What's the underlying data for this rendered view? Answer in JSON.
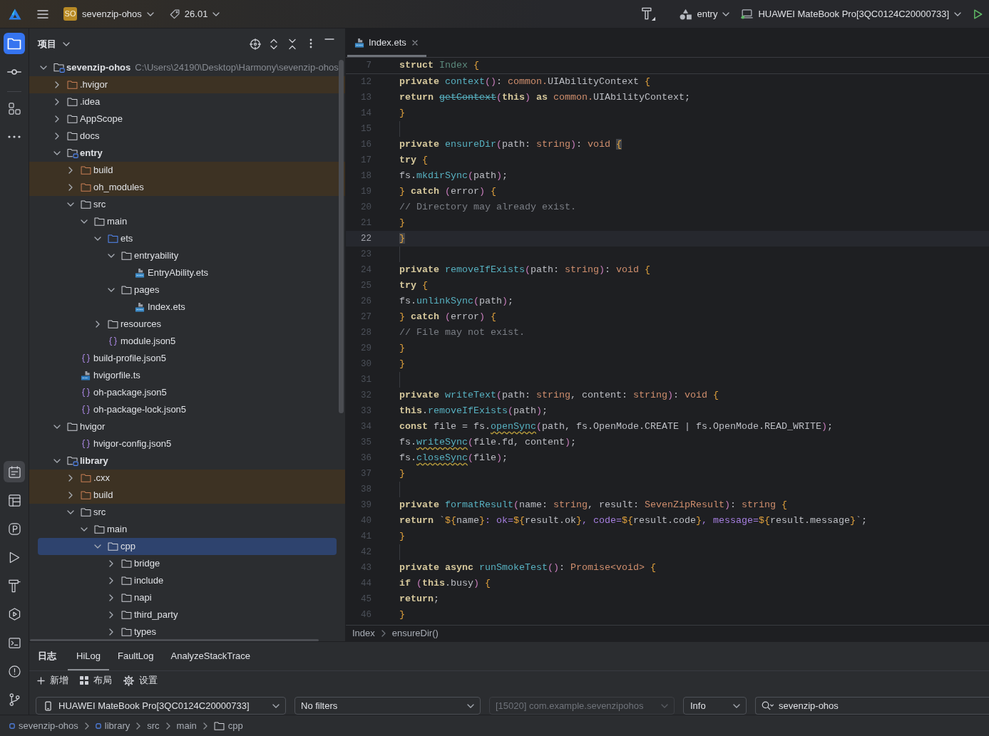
{
  "top_bar": {
    "project_badge": "SO",
    "project": "sevenzip-ohos",
    "version": "26.01",
    "module": "entry",
    "device": "HUAWEI MateBook Pro[3QC0124C20000733]"
  },
  "tool_strip": {
    "top_groups": [
      [
        {
          "kind": "project",
          "selected": true,
          "focused": true
        },
        {
          "kind": "commit",
          "selected": false,
          "focused": false
        }
      ],
      [
        {
          "kind": "structure",
          "selected": false,
          "focused": false
        },
        {
          "kind": "more",
          "selected": false,
          "focused": false
        }
      ]
    ],
    "bottom": [
      {
        "kind": "notes",
        "selected": true,
        "focused": false
      },
      {
        "kind": "layout",
        "selected": false,
        "focused": false
      },
      {
        "kind": "profiler",
        "selected": false,
        "focused": false
      },
      {
        "kind": "run",
        "selected": false,
        "focused": false
      },
      {
        "kind": "build",
        "selected": false,
        "focused": false
      },
      {
        "kind": "services",
        "selected": false,
        "focused": false
      },
      {
        "kind": "terminal",
        "selected": false,
        "focused": false
      },
      {
        "kind": "problems",
        "selected": false,
        "focused": false
      },
      {
        "kind": "git",
        "selected": false,
        "focused": false
      }
    ]
  },
  "project_panel": {
    "title": "项目",
    "tree": [
      {
        "label": "sevenzip-ohos",
        "kind": "module",
        "path": "C:\\Users\\24190\\Desktop\\Harmony\\sevenzip-ohos",
        "expanded": true,
        "selected": false,
        "children": [
          {
            "label": ".hvigor",
            "kind": "excluded",
            "expanded": false,
            "selected": false
          },
          {
            "label": ".idea",
            "kind": "folder",
            "expanded": false,
            "selected": false
          },
          {
            "label": "AppScope",
            "kind": "folder",
            "expanded": false,
            "selected": false
          },
          {
            "label": "docs",
            "kind": "folder",
            "expanded": false,
            "selected": false
          },
          {
            "label": "entry",
            "kind": "module",
            "expanded": true,
            "selected": false,
            "children": [
              {
                "label": "build",
                "kind": "excluded",
                "expanded": false,
                "selected": false
              },
              {
                "label": "oh_modules",
                "kind": "excluded",
                "expanded": false,
                "selected": false
              },
              {
                "label": "src",
                "kind": "folder",
                "expanded": true,
                "selected": false,
                "children": [
                  {
                    "label": "main",
                    "kind": "folder",
                    "expanded": true,
                    "selected": false,
                    "children": [
                      {
                        "label": "ets",
                        "kind": "source",
                        "expanded": true,
                        "selected": false,
                        "children": [
                          {
                            "label": "entryability",
                            "kind": "folder",
                            "expanded": true,
                            "selected": false,
                            "children": [
                              {
                                "label": "EntryAbility.ets",
                                "kind": "ets",
                                "selected": false
                              }
                            ]
                          },
                          {
                            "label": "pages",
                            "kind": "folder",
                            "expanded": true,
                            "selected": false,
                            "children": [
                              {
                                "label": "Index.ets",
                                "kind": "ets",
                                "selected": false
                              }
                            ]
                          }
                        ]
                      },
                      {
                        "label": "resources",
                        "kind": "folder",
                        "expanded": false,
                        "selected": false
                      },
                      {
                        "label": "module.json5",
                        "kind": "json",
                        "selected": false
                      }
                    ]
                  }
                ]
              },
              {
                "label": "build-profile.json5",
                "kind": "json",
                "selected": false
              },
              {
                "label": "hvigorfile.ts",
                "kind": "ts",
                "selected": false
              },
              {
                "label": "oh-package.json5",
                "kind": "json",
                "selected": false
              },
              {
                "label": "oh-package-lock.json5",
                "kind": "json",
                "selected": false
              }
            ]
          },
          {
            "label": "hvigor",
            "kind": "folder",
            "expanded": true,
            "selected": false,
            "children": [
              {
                "label": "hvigor-config.json5",
                "kind": "json",
                "selected": false
              }
            ]
          },
          {
            "label": "library",
            "kind": "module",
            "expanded": true,
            "selected": false,
            "children": [
              {
                "label": ".cxx",
                "kind": "excluded",
                "expanded": false,
                "selected": false
              },
              {
                "label": "build",
                "kind": "excluded",
                "expanded": false,
                "selected": false
              },
              {
                "label": "src",
                "kind": "folder",
                "expanded": true,
                "selected": false,
                "children": [
                  {
                    "label": "main",
                    "kind": "folder",
                    "expanded": true,
                    "selected": false,
                    "children": [
                      {
                        "label": "cpp",
                        "kind": "folder",
                        "expanded": true,
                        "selected": true,
                        "children": [
                          {
                            "label": "bridge",
                            "kind": "folder",
                            "expanded": false,
                            "selected": false
                          },
                          {
                            "label": "include",
                            "kind": "folder",
                            "expanded": false,
                            "selected": false
                          },
                          {
                            "label": "napi",
                            "kind": "folder",
                            "expanded": false,
                            "selected": false
                          },
                          {
                            "label": "third_party",
                            "kind": "folder",
                            "expanded": false,
                            "selected": false
                          },
                          {
                            "label": "types",
                            "kind": "folder",
                            "expanded": false,
                            "selected": false
                          }
                        ]
                      }
                    ]
                  }
                ]
              }
            ]
          }
        ]
      }
    ]
  },
  "editor": {
    "tabs": [
      {
        "label": "Index.ets",
        "selected": true
      }
    ],
    "sticky_line": {
      "number": "7",
      "tokens": [
        {
          "kind": "keyword",
          "text": "struct "
        },
        {
          "kind": "class",
          "text": "Index "
        },
        {
          "kind": "brace",
          "text": "{"
        }
      ]
    },
    "lines": [
      {
        "number": "12",
        "current": false,
        "tokens": [
          {
            "kind": "keyword",
            "text": "  private "
          },
          {
            "kind": "function",
            "text": "context"
          },
          {
            "kind": "paren",
            "text": "()"
          },
          {
            "kind": "plain",
            "text": ": "
          },
          {
            "kind": "type",
            "text": "common."
          },
          {
            "kind": "plain",
            "text": "UIAbilityContext "
          },
          {
            "kind": "brace",
            "text": "{"
          }
        ]
      },
      {
        "number": "13",
        "current": false,
        "tokens": [
          {
            "kind": "keyword",
            "text": "    return "
          },
          {
            "kind": "deprecated",
            "text": "getContext"
          },
          {
            "kind": "paren",
            "text": "("
          },
          {
            "kind": "keyword",
            "text": "this"
          },
          {
            "kind": "paren",
            "text": ") "
          },
          {
            "kind": "keyword",
            "text": "as "
          },
          {
            "kind": "type",
            "text": "common."
          },
          {
            "kind": "plain",
            "text": "UIAbilityContext;"
          }
        ]
      },
      {
        "number": "14",
        "current": false,
        "tokens": [
          {
            "kind": "brace",
            "text": "  }"
          }
        ]
      },
      {
        "number": "15",
        "current": false
      },
      {
        "number": "16",
        "current": false,
        "tokens": [
          {
            "kind": "keyword",
            "text": "  private "
          },
          {
            "kind": "function",
            "text": "ensureDir"
          },
          {
            "kind": "paren",
            "text": "("
          },
          {
            "kind": "plain",
            "text": "path: "
          },
          {
            "kind": "type",
            "text": "string"
          },
          {
            "kind": "paren",
            "text": ")"
          },
          {
            "kind": "plain",
            "text": ": "
          },
          {
            "kind": "type",
            "text": "void "
          },
          {
            "kind": "bracematch",
            "text": "{"
          }
        ]
      },
      {
        "number": "17",
        "current": false,
        "tokens": [
          {
            "kind": "keyword",
            "text": "    try "
          },
          {
            "kind": "brace",
            "text": "{"
          }
        ]
      },
      {
        "number": "18",
        "current": false,
        "tokens": [
          {
            "kind": "plain",
            "text": "      fs."
          },
          {
            "kind": "function",
            "text": "mkdirSync"
          },
          {
            "kind": "paren",
            "text": "("
          },
          {
            "kind": "plain",
            "text": "path"
          },
          {
            "kind": "paren",
            "text": ")"
          },
          {
            "kind": "plain",
            "text": ";"
          }
        ]
      },
      {
        "number": "19",
        "current": false,
        "tokens": [
          {
            "kind": "brace",
            "text": "    } "
          },
          {
            "kind": "keyword",
            "text": "catch "
          },
          {
            "kind": "paren",
            "text": "("
          },
          {
            "kind": "plain",
            "text": "error"
          },
          {
            "kind": "paren",
            "text": ") "
          },
          {
            "kind": "brace",
            "text": "{"
          }
        ]
      },
      {
        "number": "20",
        "current": false,
        "tokens": [
          {
            "kind": "comment",
            "text": "      // Directory may already exist."
          }
        ]
      },
      {
        "number": "21",
        "current": false,
        "tokens": [
          {
            "kind": "brace",
            "text": "    }"
          }
        ]
      },
      {
        "number": "22",
        "current": true,
        "tokens": [
          {
            "kind": "bracematch",
            "text": "  }"
          }
        ]
      },
      {
        "number": "23",
        "current": false
      },
      {
        "number": "24",
        "current": false,
        "tokens": [
          {
            "kind": "keyword",
            "text": "  private "
          },
          {
            "kind": "function",
            "text": "removeIfExists"
          },
          {
            "kind": "paren",
            "text": "("
          },
          {
            "kind": "plain",
            "text": "path: "
          },
          {
            "kind": "type",
            "text": "string"
          },
          {
            "kind": "paren",
            "text": ")"
          },
          {
            "kind": "plain",
            "text": ": "
          },
          {
            "kind": "type",
            "text": "void "
          },
          {
            "kind": "brace",
            "text": "{"
          }
        ]
      },
      {
        "number": "25",
        "current": false,
        "tokens": [
          {
            "kind": "keyword",
            "text": "    try "
          },
          {
            "kind": "brace",
            "text": "{"
          }
        ]
      },
      {
        "number": "26",
        "current": false,
        "tokens": [
          {
            "kind": "plain",
            "text": "      fs."
          },
          {
            "kind": "function",
            "text": "unlinkSync"
          },
          {
            "kind": "paren",
            "text": "("
          },
          {
            "kind": "plain",
            "text": "path"
          },
          {
            "kind": "paren",
            "text": ")"
          },
          {
            "kind": "plain",
            "text": ";"
          }
        ]
      },
      {
        "number": "27",
        "current": false,
        "tokens": [
          {
            "kind": "brace",
            "text": "    } "
          },
          {
            "kind": "keyword",
            "text": "catch "
          },
          {
            "kind": "paren",
            "text": "("
          },
          {
            "kind": "plain",
            "text": "error"
          },
          {
            "kind": "paren",
            "text": ") "
          },
          {
            "kind": "brace",
            "text": "{"
          }
        ]
      },
      {
        "number": "28",
        "current": false,
        "tokens": [
          {
            "kind": "comment",
            "text": "      // File may not exist."
          }
        ]
      },
      {
        "number": "29",
        "current": false,
        "tokens": [
          {
            "kind": "brace",
            "text": "    }"
          }
        ]
      },
      {
        "number": "30",
        "current": false,
        "tokens": [
          {
            "kind": "brace",
            "text": "  }"
          }
        ]
      },
      {
        "number": "31",
        "current": false
      },
      {
        "number": "32",
        "current": false,
        "tokens": [
          {
            "kind": "keyword",
            "text": "  private "
          },
          {
            "kind": "function",
            "text": "writeText"
          },
          {
            "kind": "paren",
            "text": "("
          },
          {
            "kind": "plain",
            "text": "path: "
          },
          {
            "kind": "type",
            "text": "string"
          },
          {
            "kind": "plain",
            "text": ", content: "
          },
          {
            "kind": "type",
            "text": "string"
          },
          {
            "kind": "paren",
            "text": ")"
          },
          {
            "kind": "plain",
            "text": ": "
          },
          {
            "kind": "type",
            "text": "void "
          },
          {
            "kind": "brace",
            "text": "{"
          }
        ]
      },
      {
        "number": "33",
        "current": false,
        "tokens": [
          {
            "kind": "keyword",
            "text": "    this"
          },
          {
            "kind": "plain",
            "text": "."
          },
          {
            "kind": "function",
            "text": "removeIfExists"
          },
          {
            "kind": "paren",
            "text": "("
          },
          {
            "kind": "plain",
            "text": "path"
          },
          {
            "kind": "paren",
            "text": ")"
          },
          {
            "kind": "plain",
            "text": ";"
          }
        ]
      },
      {
        "number": "34",
        "current": false,
        "tokens": [
          {
            "kind": "keyword",
            "text": "    const "
          },
          {
            "kind": "plain",
            "text": "file = fs."
          },
          {
            "kind": "flagged",
            "text": "openSync"
          },
          {
            "kind": "paren",
            "text": "("
          },
          {
            "kind": "plain",
            "text": "path, fs.OpenMode.CREATE | fs.OpenMode.READ_WRITE"
          },
          {
            "kind": "paren",
            "text": ")"
          },
          {
            "kind": "plain",
            "text": ";"
          }
        ]
      },
      {
        "number": "35",
        "current": false,
        "tokens": [
          {
            "kind": "plain",
            "text": "    fs."
          },
          {
            "kind": "flagged",
            "text": "writeSync"
          },
          {
            "kind": "paren",
            "text": "("
          },
          {
            "kind": "plain",
            "text": "file.fd, content"
          },
          {
            "kind": "paren",
            "text": ")"
          },
          {
            "kind": "plain",
            "text": ";"
          }
        ]
      },
      {
        "number": "36",
        "current": false,
        "tokens": [
          {
            "kind": "plain",
            "text": "    fs."
          },
          {
            "kind": "flagged",
            "text": "closeSync"
          },
          {
            "kind": "paren",
            "text": "("
          },
          {
            "kind": "plain",
            "text": "file"
          },
          {
            "kind": "paren",
            "text": ")"
          },
          {
            "kind": "plain",
            "text": ";"
          }
        ]
      },
      {
        "number": "37",
        "current": false,
        "tokens": [
          {
            "kind": "brace",
            "text": "  }"
          }
        ]
      },
      {
        "number": "38",
        "current": false
      },
      {
        "number": "39",
        "current": false,
        "tokens": [
          {
            "kind": "keyword",
            "text": "  private "
          },
          {
            "kind": "function",
            "text": "formatResult"
          },
          {
            "kind": "paren",
            "text": "("
          },
          {
            "kind": "plain",
            "text": "name: "
          },
          {
            "kind": "type",
            "text": "string"
          },
          {
            "kind": "plain",
            "text": ", result: "
          },
          {
            "kind": "type",
            "text": "SevenZipResult"
          },
          {
            "kind": "paren",
            "text": ")"
          },
          {
            "kind": "plain",
            "text": ": "
          },
          {
            "kind": "type",
            "text": "string "
          },
          {
            "kind": "brace",
            "text": "{"
          }
        ]
      },
      {
        "number": "40",
        "current": false,
        "tokens": [
          {
            "kind": "keyword",
            "text": "    return "
          },
          {
            "kind": "plain",
            "text": "`"
          },
          {
            "kind": "brace",
            "text": "${"
          },
          {
            "kind": "plain",
            "text": "name"
          },
          {
            "kind": "brace",
            "text": "}"
          },
          {
            "kind": "template",
            "text": ": ok="
          },
          {
            "kind": "brace",
            "text": "${"
          },
          {
            "kind": "plain",
            "text": "result.ok"
          },
          {
            "kind": "brace",
            "text": "}"
          },
          {
            "kind": "template",
            "text": ", code="
          },
          {
            "kind": "brace",
            "text": "${"
          },
          {
            "kind": "plain",
            "text": "result.code"
          },
          {
            "kind": "brace",
            "text": "}"
          },
          {
            "kind": "template",
            "text": ", message="
          },
          {
            "kind": "brace",
            "text": "${"
          },
          {
            "kind": "plain",
            "text": "result.message"
          },
          {
            "kind": "brace",
            "text": "}"
          },
          {
            "kind": "plain",
            "text": "`;"
          }
        ]
      },
      {
        "number": "41",
        "current": false,
        "tokens": [
          {
            "kind": "brace",
            "text": "  }"
          }
        ]
      },
      {
        "number": "42",
        "current": false
      },
      {
        "number": "43",
        "current": false,
        "tokens": [
          {
            "kind": "keyword",
            "text": "  private async "
          },
          {
            "kind": "function",
            "text": "runSmokeTest"
          },
          {
            "kind": "paren",
            "text": "()"
          },
          {
            "kind": "plain",
            "text": ": "
          },
          {
            "kind": "type",
            "text": "Promise<void> "
          },
          {
            "kind": "brace",
            "text": "{"
          }
        ]
      },
      {
        "number": "44",
        "current": false,
        "tokens": [
          {
            "kind": "keyword",
            "text": "    if "
          },
          {
            "kind": "paren",
            "text": "("
          },
          {
            "kind": "keyword",
            "text": "this"
          },
          {
            "kind": "plain",
            "text": ".busy"
          },
          {
            "kind": "paren",
            "text": ") "
          },
          {
            "kind": "brace",
            "text": "{"
          }
        ]
      },
      {
        "number": "45",
        "current": false,
        "tokens": [
          {
            "kind": "keyword",
            "text": "      return"
          },
          {
            "kind": "plain",
            "text": ";"
          }
        ]
      },
      {
        "number": "46",
        "current": false,
        "tokens": [
          {
            "kind": "brace",
            "text": "    }"
          }
        ]
      }
    ],
    "breadcrumb": [
      "Index",
      "ensureDir()"
    ]
  },
  "log_panel": {
    "title": "日志",
    "tabs": [
      {
        "label": "HiLog",
        "selected": true
      },
      {
        "label": "FaultLog",
        "selected": false
      },
      {
        "label": "AnalyzeStackTrace",
        "selected": false
      }
    ],
    "actions": [
      {
        "kind": "add",
        "label": "新增"
      },
      {
        "kind": "layout",
        "label": "布局"
      },
      {
        "kind": "settings",
        "label": "设置"
      }
    ],
    "filters": [
      {
        "kind": "device",
        "text": "HUAWEI MateBook Pro[3QC0124C20000733]",
        "disabled": false
      },
      {
        "kind": "dropdown",
        "text": "No filters",
        "disabled": false
      },
      {
        "kind": "dropdown",
        "text": "[15020] com.example.sevenzipohos",
        "disabled": true
      },
      {
        "kind": "dropdown",
        "text": "Info",
        "disabled": false
      },
      {
        "kind": "search",
        "value": "sevenzip-ohos"
      }
    ]
  },
  "status_bar": {
    "path": [
      {
        "label": "sevenzip-ohos",
        "kind": "module"
      },
      {
        "label": "library",
        "kind": "module"
      },
      {
        "label": "src",
        "kind": "plain"
      },
      {
        "label": "main",
        "kind": "plain"
      },
      {
        "label": "cpp",
        "kind": "folder"
      }
    ]
  }
}
